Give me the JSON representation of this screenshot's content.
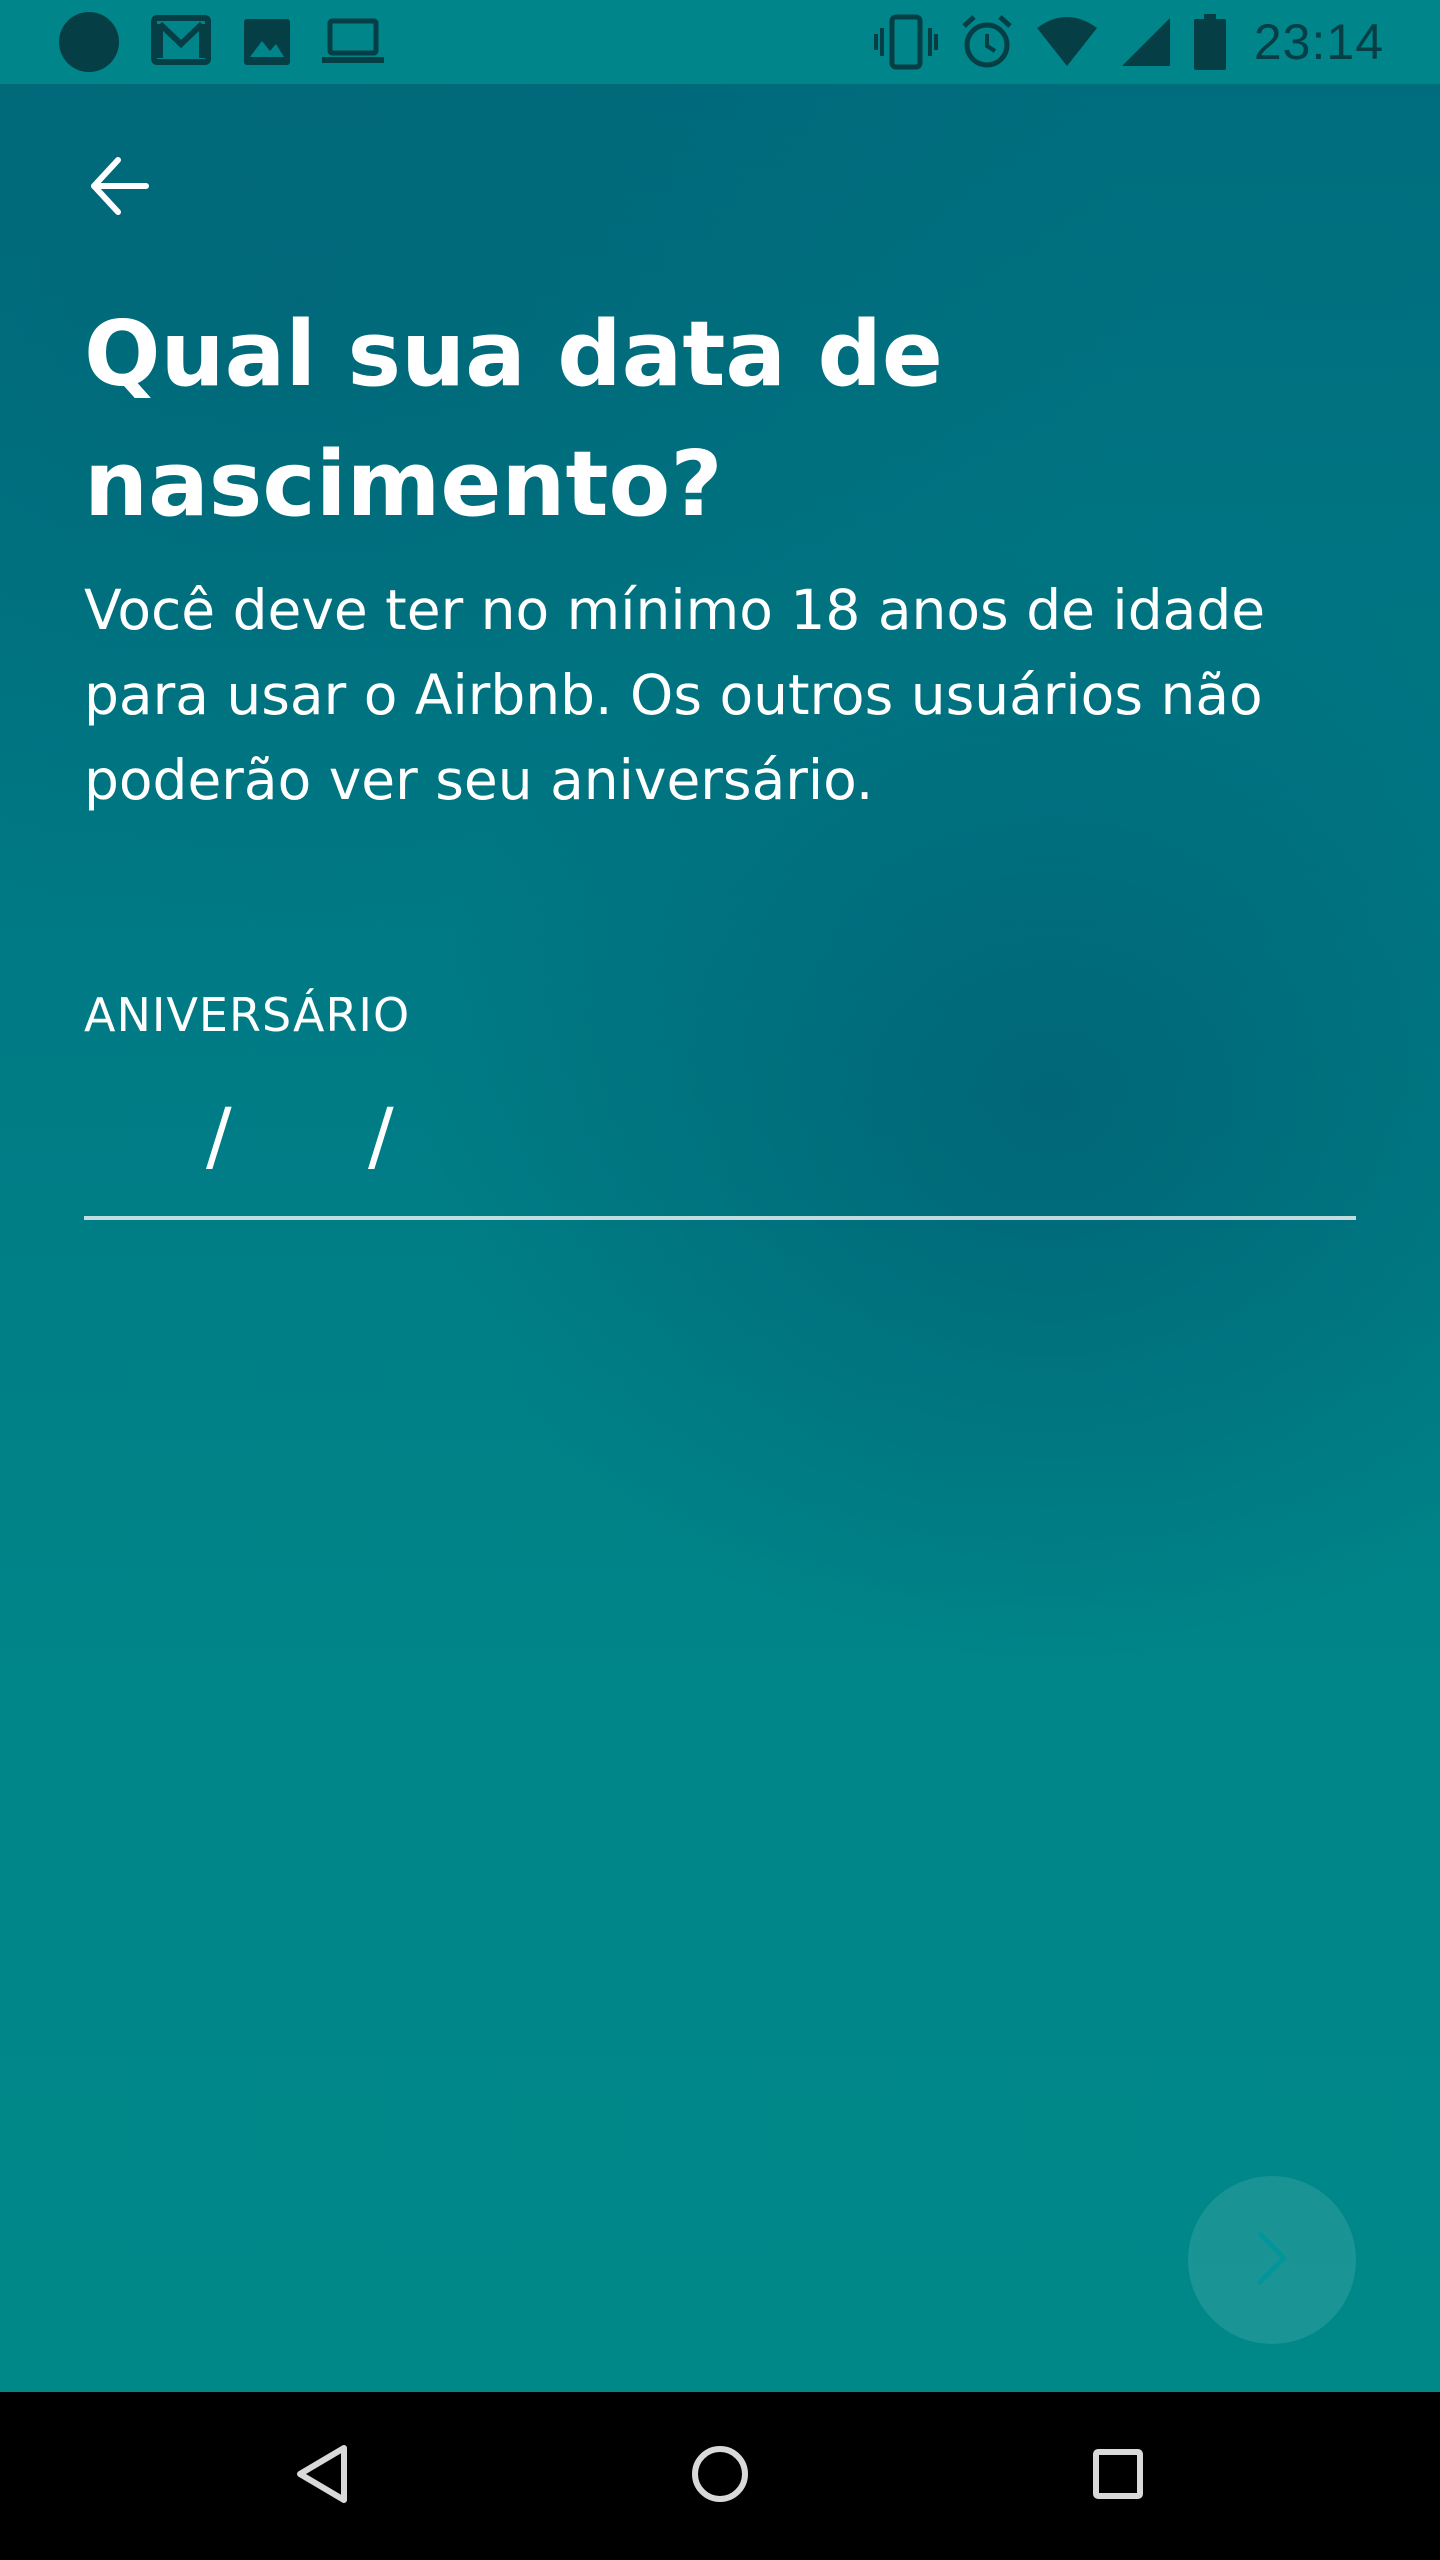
{
  "status_bar": {
    "time": "23:14",
    "left_icons": [
      "circle-icon",
      "gmail-icon",
      "image-icon",
      "laptop-icon"
    ],
    "right_icons": [
      "vibrate-icon",
      "alarm-icon",
      "wifi-icon",
      "signal-icon",
      "battery-icon"
    ]
  },
  "header": {
    "back_icon": "arrow-left-icon"
  },
  "main": {
    "title": "Qual sua data de\nnascimento?",
    "description": "Você deve ter no mínimo 18 anos de idade para usar o Airbnb. Os outros usuários não poderão ver seu aniversário.",
    "birthday_field": {
      "label": "ANIVERSÁRIO",
      "separator_1": "/",
      "separator_2": "/",
      "value": ""
    },
    "next_button": {
      "icon": "chevron-right-icon",
      "enabled": false
    }
  },
  "nav_bar": {
    "back_icon": "triangle-back-icon",
    "home_icon": "circle-home-icon",
    "recents_icon": "square-recents-icon"
  },
  "colors": {
    "background_top": "#006C7D",
    "background_bottom": "#008889",
    "status_bar": "#00868A",
    "text": "#FFFFFF",
    "nav_bar": "#000000"
  }
}
